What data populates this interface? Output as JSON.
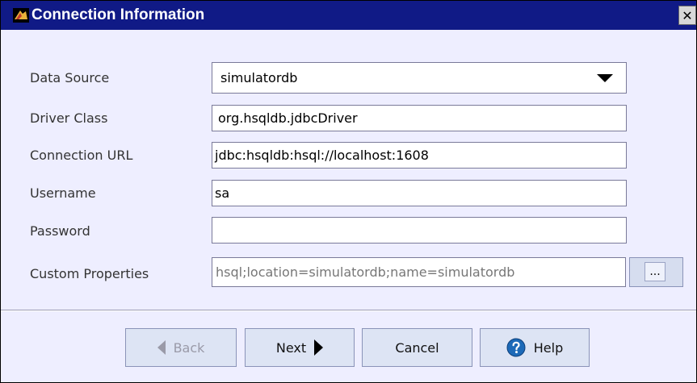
{
  "dialog": {
    "title": "Connection Information",
    "close_glyph": "✕"
  },
  "form": {
    "data_source": {
      "label": "Data Source",
      "value": "simulatordb"
    },
    "driver_class": {
      "label": "Driver Class",
      "value": "org.hsqldb.jdbcDriver"
    },
    "connection_url": {
      "label": "Connection URL",
      "value": "jdbc:hsqldb:hsql://localhost:1608"
    },
    "username": {
      "label": "Username",
      "value": "sa"
    },
    "password": {
      "label": "Password",
      "value": ""
    },
    "custom_properties": {
      "label": "Custom Properties",
      "value": "hsql;location=simulatordb;name=simulatordb",
      "button_label": "..."
    }
  },
  "buttons": {
    "back": "Back",
    "next": "Next",
    "cancel": "Cancel",
    "help": "Help"
  },
  "colors": {
    "titlebar": "#101a86",
    "dialog_background": "#eeeeff",
    "button_background": "#dde4f4",
    "help_icon": "#1d6ab8"
  },
  "icons": {
    "title": "app-logo-icon",
    "dropdown": "dropdown-arrow-icon",
    "back": "left-triangle-icon",
    "next": "right-triangle-icon",
    "help": "question-mark-icon"
  }
}
